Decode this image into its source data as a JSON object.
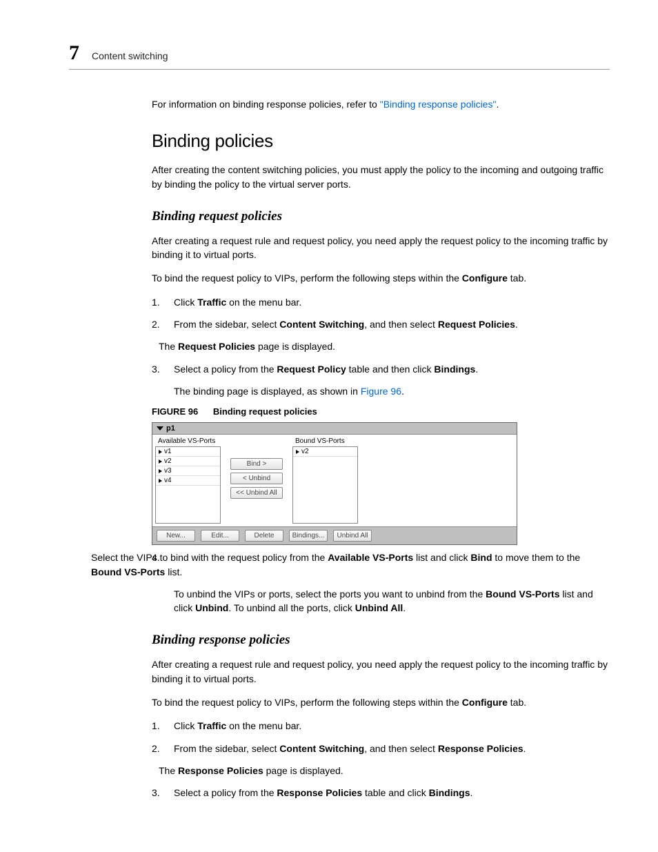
{
  "header": {
    "chapter": "7",
    "title": "Content switching"
  },
  "intro": {
    "text_pre": "For information on binding response policies, refer to ",
    "link": "\"Binding response policies\"",
    "text_post": "."
  },
  "h_binding_policies": "Binding policies",
  "p_binding_policies": "After creating the content switching policies, you must apply the policy to the incoming and outgoing traffic by binding the policy to the virtual server ports.",
  "h_binding_request": "Binding request policies",
  "p_request_1": "After creating a request rule and request policy, you need apply the request policy to the incoming traffic by binding it to virtual ports.",
  "p_request_2_pre": "To bind the request policy to VIPs, perform the following steps within the ",
  "p_request_2_bold": "Configure",
  "p_request_2_post": " tab.",
  "req_steps": {
    "s1_pre": "Click ",
    "s1_bold": "Traffic",
    "s1_post": " on the menu bar.",
    "s2_pre": "From the sidebar, select ",
    "s2_b1": "Content Switching",
    "s2_mid": ", and then select ",
    "s2_b2": "Request Policies",
    "s2_post": ".",
    "s2_sub_pre": "The ",
    "s2_sub_b": "Request Policies",
    "s2_sub_post": " page is displayed.",
    "s3_pre": "Select a policy from the ",
    "s3_b1": "Request Policy",
    "s3_mid": " table and then click ",
    "s3_b2": "Bindings",
    "s3_post": ".",
    "s3_sub_pre": "The binding page is displayed, as shown in ",
    "s3_sub_link": "Figure 96",
    "s3_sub_post": "."
  },
  "figure": {
    "label": "FIGURE 96",
    "title": "Binding request policies",
    "policy_name": "p1",
    "avail_label": "Available VS-Ports",
    "bound_label": "Bound VS-Ports",
    "avail_items": [
      "v1",
      "v2",
      "v3",
      "v4"
    ],
    "bound_items": [
      "v2"
    ],
    "btn_bind": "Bind >",
    "btn_unbind": "< Unbind",
    "btn_unbind_all": "<< Unbind All",
    "bottom": {
      "new": "New...",
      "edit": "Edit...",
      "delete": "Delete",
      "bindings": "Bindings...",
      "unbind_all": "Unbind All"
    }
  },
  "req_step4": {
    "num": "4.",
    "pre": "Select the VIPs to bind with the request policy from the ",
    "b1": "Available VS-Ports",
    "mid1": " list and click ",
    "b2": "Bind",
    "mid2": " to move them to the ",
    "b3": "Bound VS-Ports",
    "post": " list.",
    "sub_pre": "To unbind the VIPs or ports, select the ports you want to unbind from the ",
    "sub_b1": "Bound VS-Ports",
    "sub_mid1": " list and click ",
    "sub_b2": "Unbind",
    "sub_mid2": ". To unbind all the ports, click ",
    "sub_b3": "Unbind All",
    "sub_post": "."
  },
  "h_binding_response": "Binding response policies",
  "p_response_1": "After creating a request rule and request policy, you need apply the request policy to the incoming traffic by binding it to virtual ports.",
  "p_response_2_pre": "To bind the request policy to VIPs, perform the following steps within the ",
  "p_response_2_bold": "Configure",
  "p_response_2_post": " tab.",
  "resp_steps": {
    "s1_pre": "Click ",
    "s1_bold": "Traffic",
    "s1_post": " on the menu bar.",
    "s2_pre": "From the sidebar, select ",
    "s2_b1": "Content Switching",
    "s2_mid": ", and then select ",
    "s2_b2": "Response Policies",
    "s2_post": ".",
    "s2_sub_pre": "The ",
    "s2_sub_b": "Response Policies",
    "s2_sub_post": " page is displayed.",
    "s3_pre": "Select a policy from the ",
    "s3_b1": "Response Policies",
    "s3_mid": " table and click ",
    "s3_b2": "Bindings",
    "s3_post": "."
  }
}
